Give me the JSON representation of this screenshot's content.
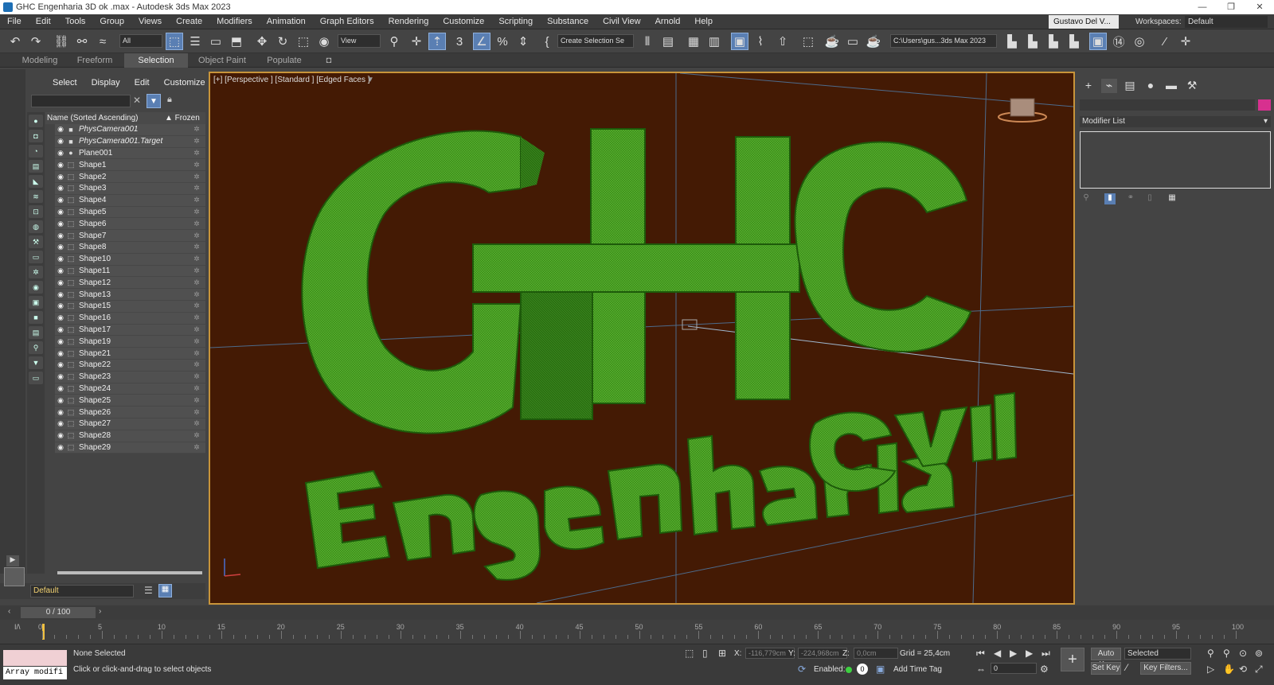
{
  "window": {
    "title": "GHC Engenharia 3D ok .max - Autodesk 3ds Max 2023",
    "controls": [
      "—",
      "❐",
      "✕"
    ]
  },
  "menu": {
    "items": [
      "File",
      "Edit",
      "Tools",
      "Group",
      "Views",
      "Create",
      "Modifiers",
      "Animation",
      "Graph Editors",
      "Rendering",
      "Customize",
      "Scripting",
      "Substance",
      "Civil View",
      "Arnold",
      "Help"
    ],
    "user": "Gustavo Del V...",
    "workspaces_label": "Workspaces:",
    "workspace_value": "Default"
  },
  "toolbar": {
    "filter_value": "All",
    "view_value": "View",
    "selection_set_value": "Create Selection Se",
    "path_value": "C:\\Users\\gus...3ds Max 2023"
  },
  "ribbon": {
    "tabs": [
      "Modeling",
      "Freeform",
      "Selection",
      "Object Paint",
      "Populate"
    ],
    "active": "Selection"
  },
  "scene_explorer": {
    "tabs": [
      "Select",
      "Display",
      "Edit",
      "Customize"
    ],
    "col_name": "Name (Sorted Ascending)",
    "col_frozen": "▲ Frozen",
    "rows": [
      {
        "name": "PhysCamera001",
        "italic": true,
        "type": "camera"
      },
      {
        "name": "PhysCamera001.Target",
        "italic": true,
        "type": "camera"
      },
      {
        "name": "Plane001",
        "italic": false,
        "type": "geo"
      },
      {
        "name": "Shape1",
        "italic": false,
        "type": "shape"
      },
      {
        "name": "Shape2",
        "italic": false,
        "type": "shape"
      },
      {
        "name": "Shape3",
        "italic": false,
        "type": "shape"
      },
      {
        "name": "Shape4",
        "italic": false,
        "type": "shape"
      },
      {
        "name": "Shape5",
        "italic": false,
        "type": "shape"
      },
      {
        "name": "Shape6",
        "italic": false,
        "type": "shape"
      },
      {
        "name": "Shape7",
        "italic": false,
        "type": "shape"
      },
      {
        "name": "Shape8",
        "italic": false,
        "type": "shape"
      },
      {
        "name": "Shape10",
        "italic": false,
        "type": "shape"
      },
      {
        "name": "Shape11",
        "italic": false,
        "type": "shape"
      },
      {
        "name": "Shape12",
        "italic": false,
        "type": "shape"
      },
      {
        "name": "Shape13",
        "italic": false,
        "type": "shape"
      },
      {
        "name": "Shape15",
        "italic": false,
        "type": "shape"
      },
      {
        "name": "Shape16",
        "italic": false,
        "type": "shape"
      },
      {
        "name": "Shape17",
        "italic": false,
        "type": "shape"
      },
      {
        "name": "Shape19",
        "italic": false,
        "type": "shape"
      },
      {
        "name": "Shape21",
        "italic": false,
        "type": "shape"
      },
      {
        "name": "Shape22",
        "italic": false,
        "type": "shape"
      },
      {
        "name": "Shape23",
        "italic": false,
        "type": "shape"
      },
      {
        "name": "Shape24",
        "italic": false,
        "type": "shape"
      },
      {
        "name": "Shape25",
        "italic": false,
        "type": "shape"
      },
      {
        "name": "Shape26",
        "italic": false,
        "type": "shape"
      },
      {
        "name": "Shape27",
        "italic": false,
        "type": "shape"
      },
      {
        "name": "Shape28",
        "italic": false,
        "type": "shape"
      },
      {
        "name": "Shape29",
        "italic": false,
        "type": "shape"
      }
    ],
    "layer_value": "Default"
  },
  "viewport": {
    "label": "[+] [Perspective ] [Standard ] [Edged Faces ]",
    "title_text": "GHC",
    "subtitle_text": "Engenharia Civil",
    "bg_color": "#441a04",
    "mesh_color": "#2f8a12"
  },
  "command_panel": {
    "modifier_list": "Modifier List",
    "color_swatch": "#d7308f"
  },
  "timeline": {
    "frame_display": "0 / 100",
    "ticks": [
      0,
      5,
      10,
      15,
      20,
      25,
      30,
      35,
      40,
      45,
      50,
      55,
      60,
      65,
      70,
      75,
      80,
      85,
      90,
      95,
      100
    ]
  },
  "status": {
    "script_field": "Array modifi",
    "selection": "None Selected",
    "prompt": "Click or click-and-drag to select objects",
    "x_label": "X:",
    "x_value": "-116,779cm",
    "y_label": "Y:",
    "y_value": "-224,968cm",
    "z_label": "Z:",
    "z_value": "0,0cm",
    "grid": "Grid = 25,4cm",
    "enabled_label": "Enabled:",
    "add_time_tag": "Add Time Tag",
    "auto_key": "Auto Key",
    "set_key": "Set Key",
    "key_mode_value": "Selected",
    "key_filters": "Key Filters...",
    "frame_value": "0"
  }
}
